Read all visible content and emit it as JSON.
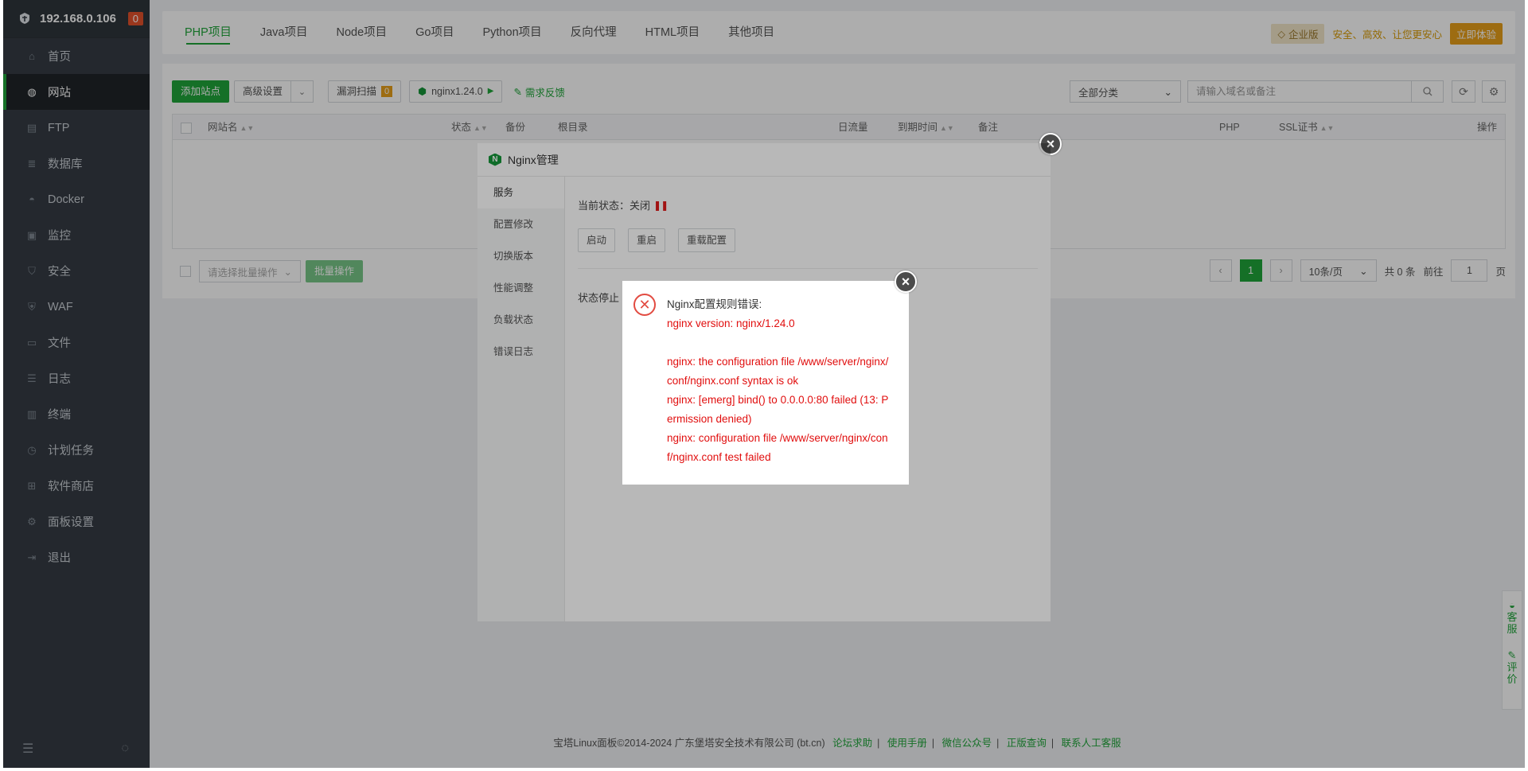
{
  "sidebar": {
    "ip": "192.168.0.106",
    "badge": "0",
    "items": [
      {
        "label": "首页",
        "icon": "home-icon"
      },
      {
        "label": "网站",
        "icon": "globe-icon",
        "active": true
      },
      {
        "label": "FTP",
        "icon": "ftp-icon"
      },
      {
        "label": "数据库",
        "icon": "database-icon"
      },
      {
        "label": "Docker",
        "icon": "docker-icon"
      },
      {
        "label": "监控",
        "icon": "monitor-icon"
      },
      {
        "label": "安全",
        "icon": "shield-icon"
      },
      {
        "label": "WAF",
        "icon": "waf-icon"
      },
      {
        "label": "文件",
        "icon": "folder-icon"
      },
      {
        "label": "日志",
        "icon": "log-icon"
      },
      {
        "label": "终端",
        "icon": "terminal-icon"
      },
      {
        "label": "计划任务",
        "icon": "clock-icon"
      },
      {
        "label": "软件商店",
        "icon": "store-icon"
      },
      {
        "label": "面板设置",
        "icon": "gear-icon"
      },
      {
        "label": "退出",
        "icon": "logout-icon"
      }
    ]
  },
  "tabs": [
    "PHP项目",
    "Java项目",
    "Node项目",
    "Go项目",
    "Python项目",
    "反向代理",
    "HTML项目",
    "其他项目"
  ],
  "promo": {
    "edition": "企业版",
    "slogan": "安全、高效、让您更安心",
    "try": "立即体验"
  },
  "toolbar": {
    "add_site": "添加站点",
    "advanced": "高级设置",
    "vuln_scan": "漏洞扫描",
    "vuln_count": "0",
    "nginx_version": "nginx1.24.0",
    "feedback": "需求反馈",
    "category": "全部分类",
    "search_placeholder": "请输入域名或备注"
  },
  "table": {
    "headers": [
      "网站名",
      "状态",
      "备份",
      "根目录",
      "日流量",
      "到期时间",
      "备注",
      "PHP",
      "SSL证书",
      "操作"
    ]
  },
  "batch": {
    "placeholder": "请选择批量操作",
    "button": "批量操作"
  },
  "pager": {
    "current": "1",
    "per_page": "10条/页",
    "total": "共 0 条",
    "goto": "前往",
    "page_input": "1",
    "page_unit": "页"
  },
  "footer": {
    "copyright": "宝塔Linux面板©2014-2024 广东堡塔安全技术有限公司 (bt.cn)",
    "links": [
      "论坛求助",
      "使用手册",
      "微信公众号",
      "正版查询",
      "联系人工客服"
    ]
  },
  "side_float": {
    "service": "客服",
    "review": "评价"
  },
  "nginx_dialog": {
    "title": "Nginx管理",
    "nav": [
      "服务",
      "配置修改",
      "切换版本",
      "性能调整",
      "负载状态",
      "错误日志"
    ],
    "status_label": "当前状态：关闭",
    "buttons": [
      "启动",
      "重启",
      "重载配置"
    ],
    "stop_note": "状态停止"
  },
  "error_dialog": {
    "title": "Nginx配置规则错误:",
    "message": "nginx version: nginx/1.24.0\n\nnginx: the configuration file /www/server/nginx/conf/nginx.conf syntax is ok\nnginx: [emerg] bind() to 0.0.0.0:80 failed (13: Permission denied)\nnginx: configuration file /www/server/nginx/conf/nginx.conf test failed"
  },
  "colors": {
    "brand": "#20a53a",
    "error": "#e10e0e",
    "sidebar": "#353c44"
  }
}
